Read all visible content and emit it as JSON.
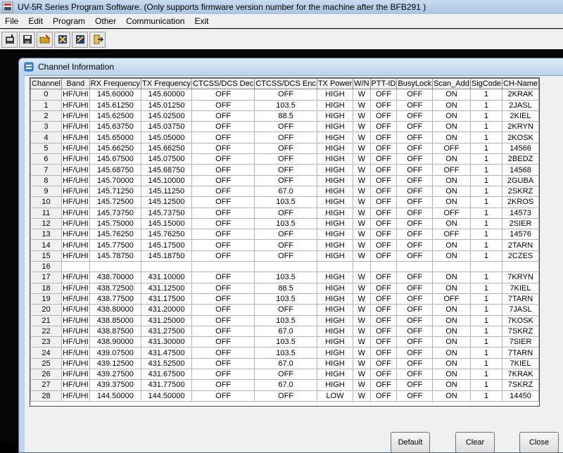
{
  "window": {
    "title": "UV-5R Series Program Software. (Only supports firmware version number for the machine after the BFB291 )"
  },
  "menu": [
    "File",
    "Edit",
    "Program",
    "Other",
    "Communication",
    "Exit"
  ],
  "toolbar": {
    "icons": [
      "read-from-radio-icon",
      "save-icon",
      "open-folder-icon",
      "write-to-radio-icon",
      "program-icon",
      "exit-icon"
    ]
  },
  "child": {
    "title": "Channel Information",
    "columns": [
      "Channel",
      "Band",
      "RX Frequency",
      "TX Frequency",
      "CTCSS/DCS Dec",
      "CTCSS/DCS Enc",
      "TX Power",
      "W/N",
      "PTT-ID",
      "BusyLock",
      "Scan_Add",
      "SigCode",
      "CH-Name"
    ],
    "rows": [
      [
        "0",
        "HF/UHI",
        "145.60000",
        "145.60000",
        "OFF",
        "OFF",
        "HIGH",
        "W",
        "OFF",
        "OFF",
        "ON",
        "1",
        "2KRAK"
      ],
      [
        "1",
        "HF/UHI",
        "145.61250",
        "145.01250",
        "OFF",
        "103.5",
        "HIGH",
        "W",
        "OFF",
        "OFF",
        "ON",
        "1",
        "2JASL"
      ],
      [
        "2",
        "HF/UHI",
        "145.62500",
        "145.02500",
        "OFF",
        "88.5",
        "HIGH",
        "W",
        "OFF",
        "OFF",
        "ON",
        "1",
        "2KIEL"
      ],
      [
        "3",
        "HF/UHI",
        "145.63750",
        "145.03750",
        "OFF",
        "OFF",
        "HIGH",
        "W",
        "OFF",
        "OFF",
        "ON",
        "1",
        "2KRYN"
      ],
      [
        "4",
        "HF/UHI",
        "145.65000",
        "145.05000",
        "OFF",
        "OFF",
        "HIGH",
        "W",
        "OFF",
        "OFF",
        "ON",
        "1",
        "2KOSK"
      ],
      [
        "5",
        "HF/UHI",
        "145.66250",
        "145.66250",
        "OFF",
        "OFF",
        "HIGH",
        "W",
        "OFF",
        "OFF",
        "OFF",
        "1",
        "14566"
      ],
      [
        "6",
        "HF/UHI",
        "145.67500",
        "145.07500",
        "OFF",
        "OFF",
        "HIGH",
        "W",
        "OFF",
        "OFF",
        "ON",
        "1",
        "2BEDZ"
      ],
      [
        "7",
        "HF/UHI",
        "145.68750",
        "145.68750",
        "OFF",
        "OFF",
        "HIGH",
        "W",
        "OFF",
        "OFF",
        "OFF",
        "1",
        "14568"
      ],
      [
        "8",
        "HF/UHI",
        "145.70000",
        "145.10000",
        "OFF",
        "OFF",
        "HIGH",
        "W",
        "OFF",
        "OFF",
        "ON",
        "1",
        "2GUBA"
      ],
      [
        "9",
        "HF/UHI",
        "145.71250",
        "145.11250",
        "OFF",
        "67.0",
        "HIGH",
        "W",
        "OFF",
        "OFF",
        "ON",
        "1",
        "2SKRZ"
      ],
      [
        "10",
        "HF/UHI",
        "145.72500",
        "145.12500",
        "OFF",
        "103.5",
        "HIGH",
        "W",
        "OFF",
        "OFF",
        "ON",
        "1",
        "2KROS"
      ],
      [
        "11",
        "HF/UHI",
        "145.73750",
        "145.73750",
        "OFF",
        "OFF",
        "HIGH",
        "W",
        "OFF",
        "OFF",
        "OFF",
        "1",
        "14573"
      ],
      [
        "12",
        "HF/UHI",
        "145.75000",
        "145.15000",
        "OFF",
        "103.5",
        "HIGH",
        "W",
        "OFF",
        "OFF",
        "ON",
        "1",
        "2SIER"
      ],
      [
        "13",
        "HF/UHI",
        "145.76250",
        "145.76250",
        "OFF",
        "OFF",
        "HIGH",
        "W",
        "OFF",
        "OFF",
        "OFF",
        "1",
        "14576"
      ],
      [
        "14",
        "HF/UHI",
        "145.77500",
        "145.17500",
        "OFF",
        "OFF",
        "HIGH",
        "W",
        "OFF",
        "OFF",
        "ON",
        "1",
        "2TARN"
      ],
      [
        "15",
        "HF/UHI",
        "145.78750",
        "145.18750",
        "OFF",
        "OFF",
        "HIGH",
        "W",
        "OFF",
        "OFF",
        "ON",
        "1",
        "2CZES"
      ],
      [
        "16",
        "",
        "",
        "",
        "",
        "",
        "",
        "",
        "",
        "",
        "",
        "",
        ""
      ],
      [
        "17",
        "HF/UHI",
        "438.70000",
        "431.10000",
        "OFF",
        "103.5",
        "HIGH",
        "W",
        "OFF",
        "OFF",
        "ON",
        "1",
        "7KRYN"
      ],
      [
        "18",
        "HF/UHI",
        "438.72500",
        "431.12500",
        "OFF",
        "88.5",
        "HIGH",
        "W",
        "OFF",
        "OFF",
        "ON",
        "1",
        "7KIEL"
      ],
      [
        "19",
        "HF/UHI",
        "438.77500",
        "431.17500",
        "OFF",
        "103.5",
        "HIGH",
        "W",
        "OFF",
        "OFF",
        "OFF",
        "1",
        "7TARN"
      ],
      [
        "20",
        "HF/UHI",
        "438.80000",
        "431.20000",
        "OFF",
        "OFF",
        "HIGH",
        "W",
        "OFF",
        "OFF",
        "ON",
        "1",
        "7JASL"
      ],
      [
        "21",
        "HF/UHI",
        "438.85000",
        "431.25000",
        "OFF",
        "103.5",
        "HIGH",
        "W",
        "OFF",
        "OFF",
        "ON",
        "1",
        "7KOSK"
      ],
      [
        "22",
        "HF/UHI",
        "438.87500",
        "431.27500",
        "OFF",
        "67.0",
        "HIGH",
        "W",
        "OFF",
        "OFF",
        "ON",
        "1",
        "7SKRZ"
      ],
      [
        "23",
        "HF/UHI",
        "438.90000",
        "431.30000",
        "OFF",
        "103.5",
        "HIGH",
        "W",
        "OFF",
        "OFF",
        "ON",
        "1",
        "7SIER"
      ],
      [
        "24",
        "HF/UHI",
        "439.07500",
        "431.47500",
        "OFF",
        "103.5",
        "HIGH",
        "W",
        "OFF",
        "OFF",
        "ON",
        "1",
        "7TARN"
      ],
      [
        "25",
        "HF/UHI",
        "439.12500",
        "431.52500",
        "OFF",
        "67.0",
        "HIGH",
        "W",
        "OFF",
        "OFF",
        "ON",
        "1",
        "7KIEL"
      ],
      [
        "26",
        "HF/UHI",
        "439.27500",
        "431.67500",
        "OFF",
        "OFF",
        "HIGH",
        "W",
        "OFF",
        "OFF",
        "ON",
        "1",
        "7KRAK"
      ],
      [
        "27",
        "HF/UHI",
        "439.37500",
        "431.77500",
        "OFF",
        "67.0",
        "HIGH",
        "W",
        "OFF",
        "OFF",
        "ON",
        "1",
        "7SKRZ"
      ],
      [
        "28",
        "HF/UHI",
        "144.50000",
        "144.50000",
        "OFF",
        "OFF",
        "LOW",
        "W",
        "OFF",
        "OFF",
        "ON",
        "1",
        "14450"
      ]
    ]
  },
  "buttons": {
    "default": "Default",
    "clear": "Clear",
    "close": "Close"
  }
}
